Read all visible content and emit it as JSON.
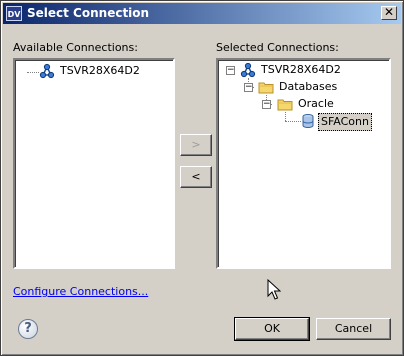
{
  "window": {
    "title": "Select Connection",
    "app_icon_text": "DV",
    "close_label": "✕"
  },
  "left": {
    "label": "Available Connections:",
    "items": [
      {
        "label": "TSVR28X64D2",
        "icon": "server-network-icon"
      }
    ]
  },
  "right": {
    "label": "Selected Connections:",
    "tree": [
      {
        "label": "TSVR28X64D2",
        "icon": "server-network-icon",
        "expander": "−"
      },
      {
        "label": "Databases",
        "icon": "folder-icon",
        "expander": "−"
      },
      {
        "label": "Oracle",
        "icon": "folder-icon",
        "expander": "−"
      },
      {
        "label": "SFAConn",
        "icon": "database-icon"
      }
    ]
  },
  "buttons": {
    "add": ">",
    "remove": "<",
    "ok": "OK",
    "cancel": "Cancel"
  },
  "configure_link": "Configure Connections...",
  "help_icon": "?"
}
